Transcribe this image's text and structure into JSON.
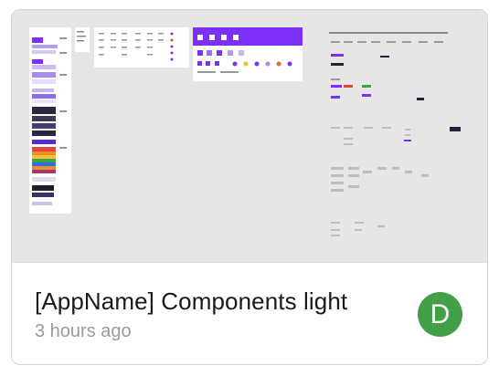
{
  "file_card": {
    "title": "[AppName] Components light",
    "edited": "3 hours ago",
    "avatar_initial": "D",
    "avatar_color": "#43a047",
    "thumbnail_description_colors": {
      "canvas": "#e6e6e6",
      "accent_purple": "#7b2ff7",
      "dark_navy": "#23233a"
    }
  }
}
